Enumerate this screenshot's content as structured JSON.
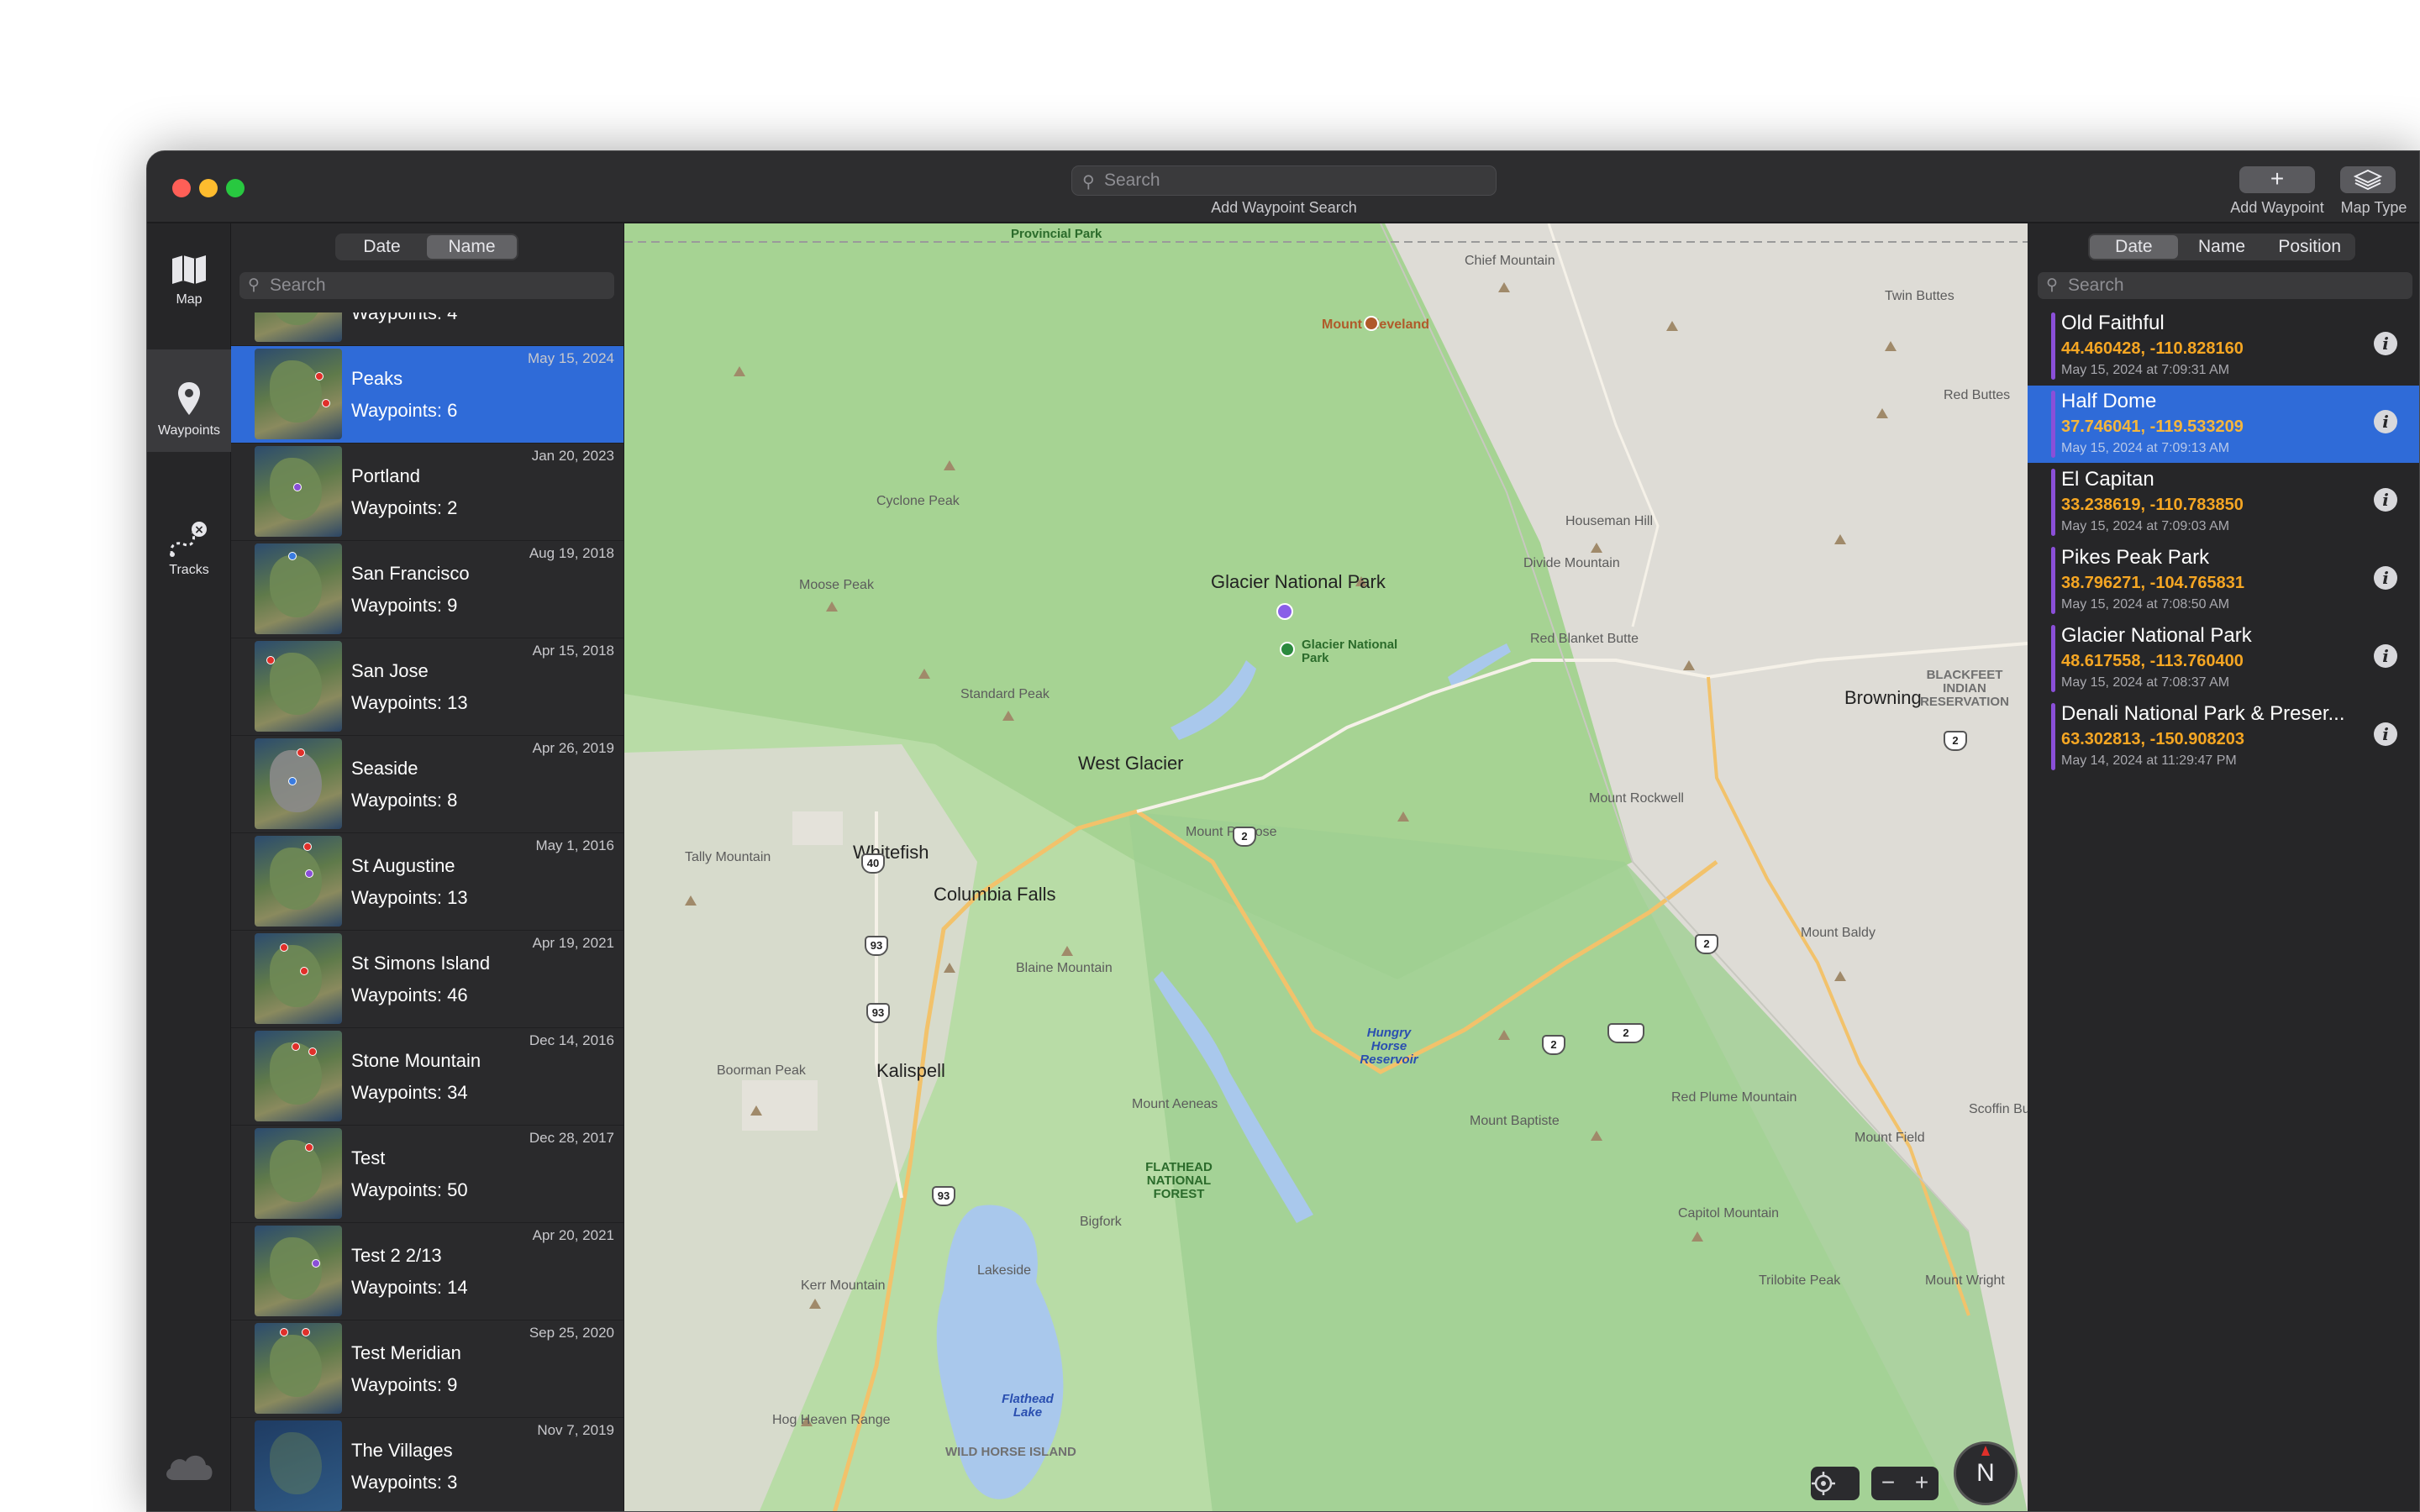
{
  "toolbar": {
    "search_placeholder": "Search",
    "search_caption": "Add Waypoint Search",
    "add_waypoint_label": "Add Waypoint",
    "map_type_label": "Map Type"
  },
  "rail": {
    "map_label": "Map",
    "waypoints_label": "Waypoints",
    "tracks_label": "Tracks"
  },
  "groups_pane": {
    "sort_options": [
      "Date",
      "Name"
    ],
    "sort_selected": "Name",
    "search_placeholder": "Search",
    "groups": [
      {
        "name": "",
        "count": "Waypoints: 4",
        "date": ""
      },
      {
        "name": "Peaks",
        "count": "Waypoints: 6",
        "date": "May 15, 2024"
      },
      {
        "name": "Portland",
        "count": "Waypoints: 2",
        "date": "Jan 20, 2023"
      },
      {
        "name": "San Francisco",
        "count": "Waypoints: 9",
        "date": "Aug 19, 2018"
      },
      {
        "name": "San Jose",
        "count": "Waypoints: 13",
        "date": "Apr 15, 2018"
      },
      {
        "name": "Seaside",
        "count": "Waypoints: 8",
        "date": "Apr 26, 2019"
      },
      {
        "name": "St Augustine",
        "count": "Waypoints: 13",
        "date": "May 1, 2016"
      },
      {
        "name": "St Simons Island",
        "count": "Waypoints: 46",
        "date": "Apr 19, 2021"
      },
      {
        "name": "Stone Mountain",
        "count": "Waypoints: 34",
        "date": "Dec 14, 2016"
      },
      {
        "name": "Test",
        "count": "Waypoints: 50",
        "date": "Dec 28, 2017"
      },
      {
        "name": "Test 2 2/13",
        "count": "Waypoints: 14",
        "date": "Apr 20, 2021"
      },
      {
        "name": "Test Meridian",
        "count": "Waypoints: 9",
        "date": "Sep 25, 2020"
      },
      {
        "name": "The Villages",
        "count": "Waypoints: 3",
        "date": "Nov 7, 2019"
      }
    ]
  },
  "map": {
    "labels": {
      "glacier_np": "Glacier National Park",
      "glacier_np_pin": "Glacier National Park",
      "west_glacier": "West Glacier",
      "whitefish": "Whitefish",
      "columbia_falls": "Columbia Falls",
      "kalispell": "Kalispell",
      "browning": "Browning",
      "blackfeet": "BLACKFEET INDIAN RESERVATION",
      "hungry_horse": "Hungry Horse Reservoir",
      "flathead_forest": "FLATHEAD NATIONAL FOREST",
      "flathead_lake": "Flathead Lake",
      "mount_cleveland": "Mount Cleveland",
      "provincial_park": "Provincial Park",
      "lakeside": "Lakeside",
      "bigfork": "Bigfork",
      "wild_horse_island": "WILD HORSE ISLAND",
      "red_blanket_butte": "Red Blanket Butte",
      "divide_mountain": "Divide Mountain",
      "houseman_hill": "Houseman Hill",
      "twin_buttes": "Twin Buttes",
      "red_buttes": "Red Buttes",
      "chief_mountain": "Chief Mountain",
      "cyclone_peak": "Cyclone Peak",
      "moose_peak": "Moose Peak",
      "standard_peak": "Standard Peak",
      "tally_mountain": "Tally Mountain",
      "boorman_peak": "Boorman Peak",
      "blaine_mountain": "Blaine Mountain",
      "mount_penrose": "Mount Penrose",
      "mount_rockwell": "Mount Rockwell",
      "mount_baldy": "Mount Baldy",
      "mount_baptiste": "Mount Baptiste",
      "red_plume_mountain": "Red Plume Mountain",
      "kerr_mountain": "Kerr Mountain",
      "hog_heaven_range": "Hog Heaven Range",
      "mount_aeneas": "Mount Aeneas",
      "scoffin_butte": "Scoffin Butte",
      "trilobite_peak": "Trilobite Peak",
      "capitol_mountain": "Capitol Mountain",
      "mount_field": "Mount Field",
      "mount_wright": "Mount Wright"
    },
    "compass_label": "N",
    "zoom_out": "−",
    "zoom_in": "+"
  },
  "waypoints_pane": {
    "sort_options": [
      "Date",
      "Name",
      "Position"
    ],
    "sort_selected": "Date",
    "search_placeholder": "Search",
    "waypoints": [
      {
        "name": "Old Faithful",
        "coords": "44.460428, -110.828160",
        "time": "May 15, 2024 at 7:09:31 AM"
      },
      {
        "name": "Half Dome",
        "coords": "37.746041, -119.533209",
        "time": "May 15, 2024 at 7:09:13 AM"
      },
      {
        "name": "El Capitan",
        "coords": "33.238619, -110.783850",
        "time": "May 15, 2024 at 7:09:03 AM"
      },
      {
        "name": "Pikes Peak Park",
        "coords": "38.796271, -104.765831",
        "time": "May 15, 2024 at 7:08:50 AM"
      },
      {
        "name": "Glacier National Park",
        "coords": "48.617558, -113.760400",
        "time": "May 15, 2024 at 7:08:37 AM"
      },
      {
        "name": "Denali National Park & Preser...",
        "coords": "63.302813, -150.908203",
        "time": "May 14, 2024 at 11:29:47 PM"
      }
    ],
    "selected_index": 1,
    "info_glyph": "i"
  },
  "colors": {
    "selection": "#2f6bd8",
    "coords": "#f5a623",
    "waypoint_bar": "#8a4fd8",
    "park_green": "#a9d39a"
  },
  "icons": {
    "map": "folded-map-icon",
    "waypoints": "location-pin-icon",
    "tracks": "dashed-track-icon",
    "cloud": "cloud-icon",
    "add": "plus-icon",
    "map_type": "layers-icon",
    "locate": "crosshair-icon",
    "info": "info-icon"
  }
}
